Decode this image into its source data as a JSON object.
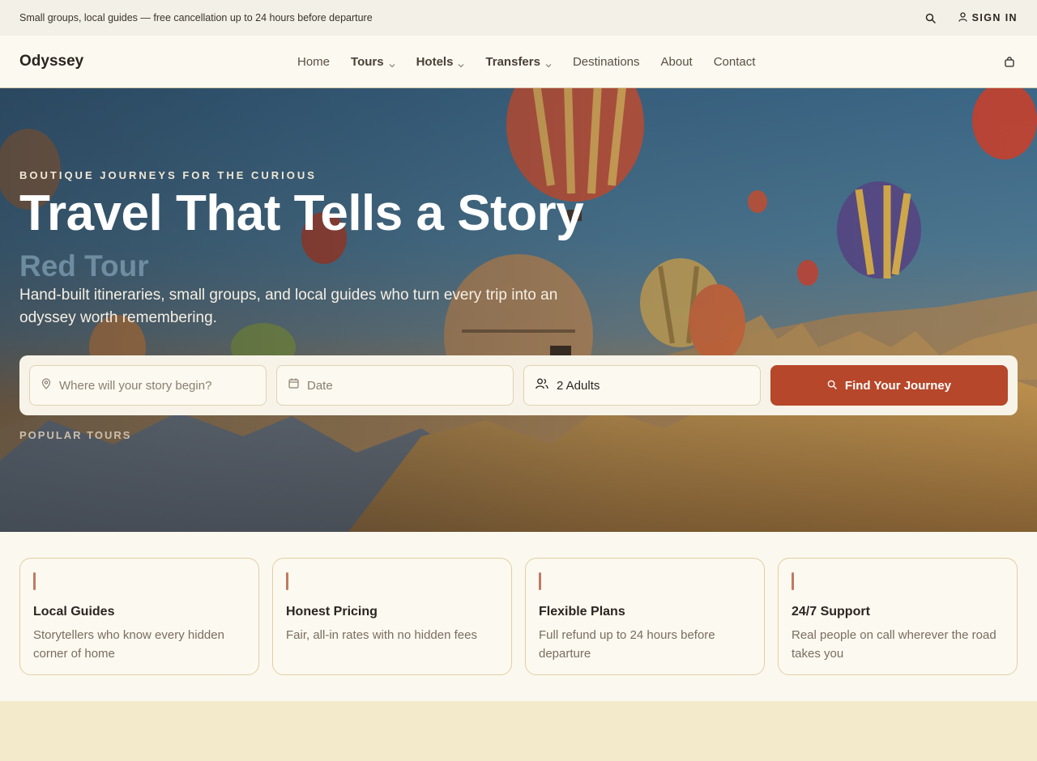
{
  "topbar": {
    "message": "Small groups, local guides — free cancellation up to 24 hours before departure",
    "search_icon": "search-icon",
    "signin_label": "SIGN IN",
    "user_icon": "user-icon"
  },
  "navbar": {
    "logo": "Odyssey",
    "links": [
      {
        "label": "Home",
        "dropdown": false
      },
      {
        "label": "Tours",
        "dropdown": true
      },
      {
        "label": "Hotels",
        "dropdown": true
      },
      {
        "label": "Transfers",
        "dropdown": true
      },
      {
        "label": "Destinations",
        "dropdown": false
      },
      {
        "label": "About",
        "dropdown": false
      },
      {
        "label": "Contact",
        "dropdown": false
      }
    ],
    "cart_icon": "shopping-bag-icon"
  },
  "hero": {
    "eyebrow": "BOUTIQUE JOURNEYS FOR THE CURIOUS",
    "title": "Travel That Tells a Story",
    "rotating_word": "Red Tour",
    "subtitle": "Hand-built itineraries, small groups, and local guides who turn every trip into an odyssey worth remembering.",
    "search": {
      "destination_placeholder": "Where will your story begin?",
      "date_placeholder": "Date",
      "guests_value": "2 Adults",
      "button_label": "Find Your Journey"
    },
    "popular_label": "POPULAR TOURS"
  },
  "features": [
    {
      "title": "Local Guides",
      "text": "Storytellers who know every hidden corner of home"
    },
    {
      "title": "Honest Pricing",
      "text": "Fair, all-in rates with no hidden fees"
    },
    {
      "title": "Flexible Plans",
      "text": "Full refund up to 24 hours before departure"
    },
    {
      "title": "24/7 Support",
      "text": "Real people on call wherever the road takes you"
    }
  ],
  "colors": {
    "accent": "#b7472a",
    "background": "#fbf8ef",
    "card_border": "#e3cfa1",
    "section_band": "#f3e9cb"
  }
}
